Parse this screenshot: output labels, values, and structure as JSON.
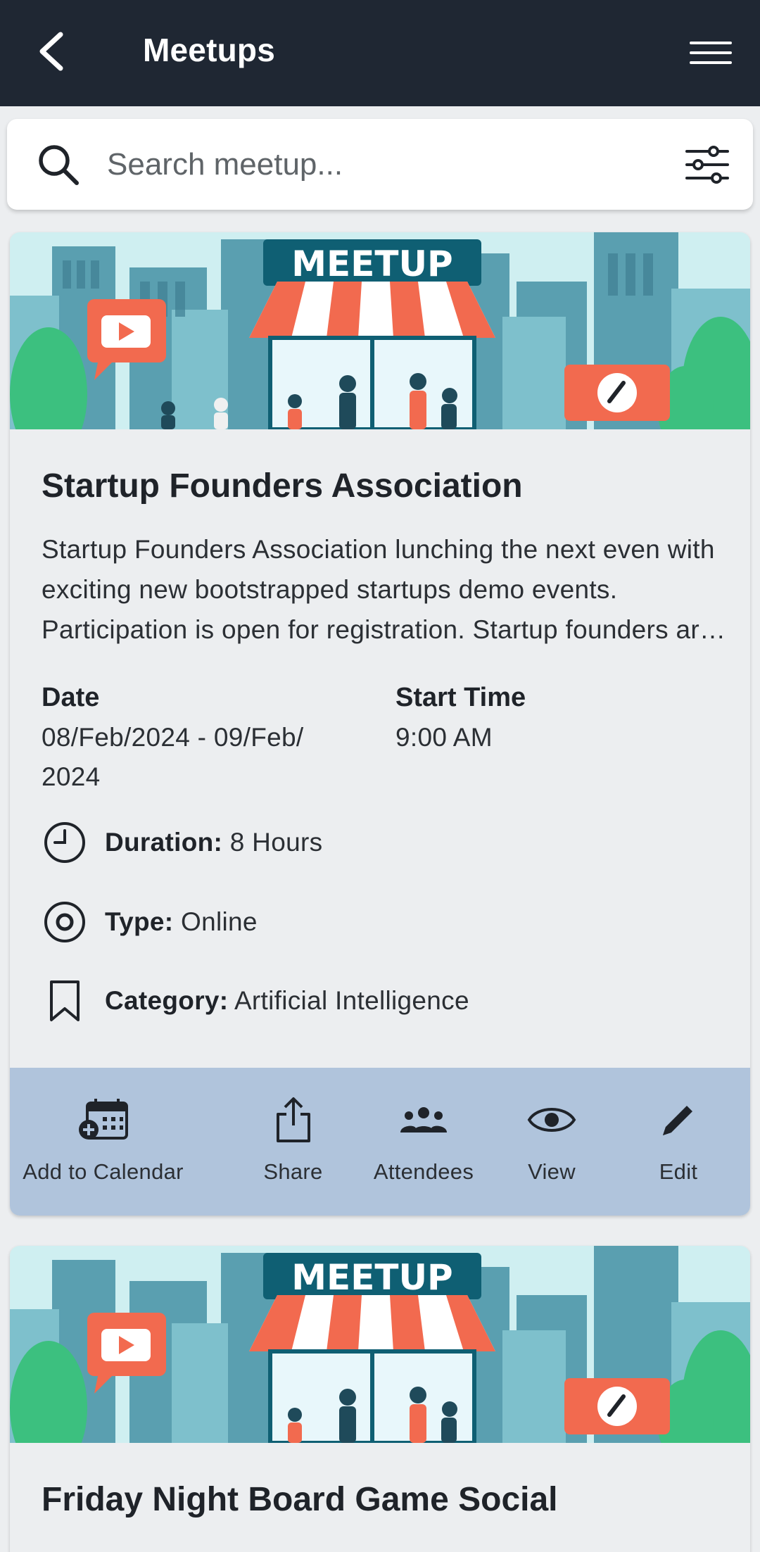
{
  "header": {
    "title": "Meetups"
  },
  "search": {
    "placeholder": "Search meetup..."
  },
  "meetups": [
    {
      "banner_text": "MEETUP",
      "title": "Startup Founders Association",
      "description": "Startup Founders Association lunching the next even with exciting new bootstrapped startups demo events. Participation is open for registration. Startup founders are invited to present.",
      "date_label": "Date",
      "date_value": "08/Feb/2024 - 09/Feb/ 2024",
      "start_time_label": "Start Time",
      "start_time_value": "9:00 AM",
      "duration_label": "Duration:",
      "duration_value": "8 Hours",
      "type_label": "Type:",
      "type_value": "Online",
      "category_label": "Category:",
      "category_value": "Artificial Intelligence",
      "actions": [
        {
          "label": "Add to Calendar",
          "icon": "calendar-add-icon"
        },
        {
          "label": "Share",
          "icon": "share-icon"
        },
        {
          "label": "Attendees",
          "icon": "people-icon"
        },
        {
          "label": "View",
          "icon": "eye-icon"
        },
        {
          "label": "Edit",
          "icon": "pencil-icon"
        }
      ]
    },
    {
      "banner_text": "MEETUP",
      "title": "Friday Night Board Game Social"
    }
  ],
  "colors": {
    "appbar": "#1f2733",
    "page_bg": "#eceef0",
    "action_bar": "#b0c4dc",
    "banner_accent": "#f26a4f",
    "banner_teal": "#2fae8a"
  }
}
